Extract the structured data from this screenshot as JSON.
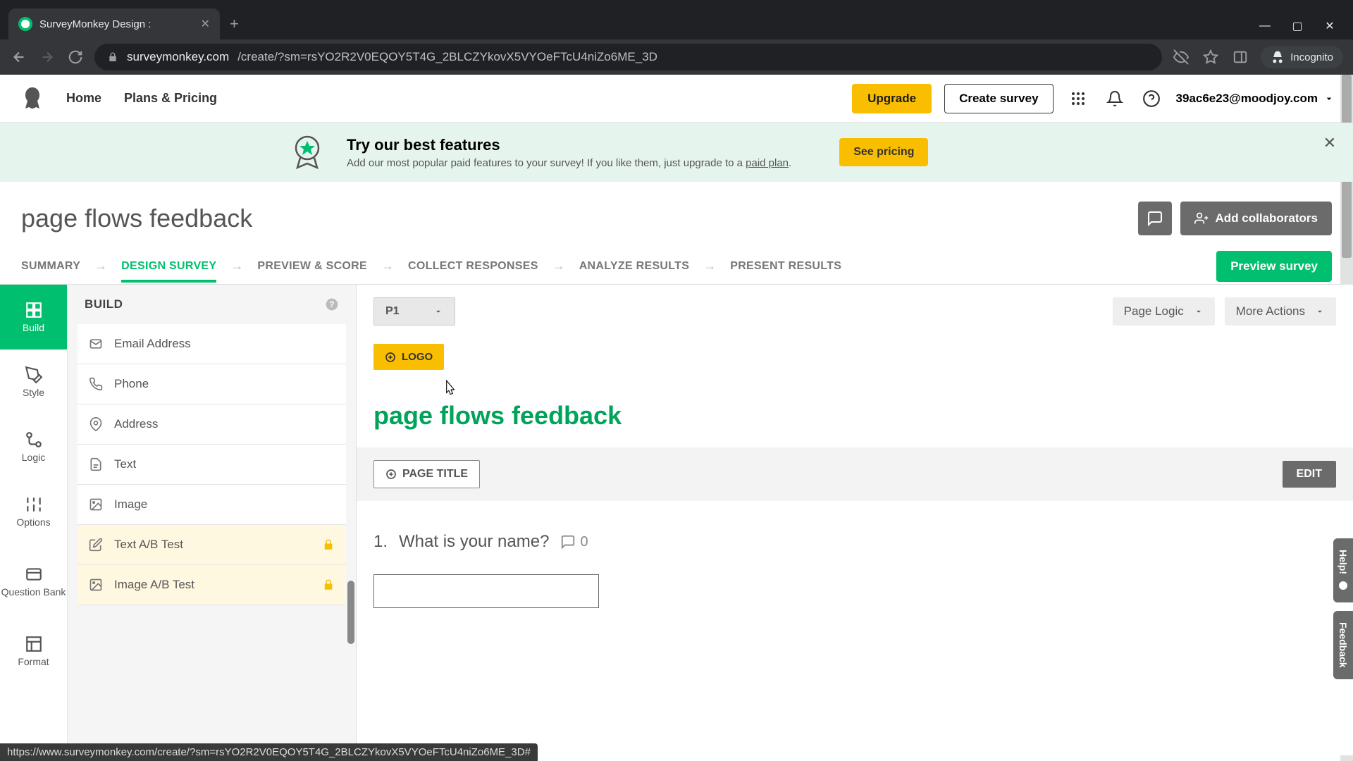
{
  "browser": {
    "tab_title": "SurveyMonkey Design :",
    "url_domain": "surveymonkey.com",
    "url_path": "/create/?sm=rsYO2R2V0EQOY5T4G_2BLCZYkovX5VYOeFTcU4niZo6ME_3D",
    "incognito_label": "Incognito"
  },
  "topnav": {
    "home": "Home",
    "plans": "Plans & Pricing",
    "upgrade": "Upgrade",
    "create_survey": "Create survey",
    "account_email": "39ac6e23@moodjoy.com"
  },
  "banner": {
    "title": "Try our best features",
    "subtitle_prefix": "Add our most popular paid features to your survey! If you like them, just upgrade to a ",
    "subtitle_link": "paid plan",
    "cta": "See pricing"
  },
  "survey": {
    "title": "page flows feedback",
    "add_collaborators": "Add collaborators"
  },
  "steps": {
    "summary": "SUMMARY",
    "design": "DESIGN SURVEY",
    "preview": "PREVIEW & SCORE",
    "collect": "COLLECT RESPONSES",
    "analyze": "ANALYZE RESULTS",
    "present": "PRESENT RESULTS",
    "preview_btn": "Preview survey"
  },
  "rail": {
    "build": "Build",
    "style": "Style",
    "logic": "Logic",
    "options": "Options",
    "question_bank": "Question Bank",
    "format": "Format"
  },
  "build_panel": {
    "header": "BUILD",
    "items": [
      {
        "label": "Email Address",
        "icon": "mail",
        "locked": false
      },
      {
        "label": "Phone",
        "icon": "phone",
        "locked": false
      },
      {
        "label": "Address",
        "icon": "pin",
        "locked": false
      },
      {
        "label": "Text",
        "icon": "text",
        "locked": false
      },
      {
        "label": "Image",
        "icon": "image",
        "locked": false
      },
      {
        "label": "Text A/B Test",
        "icon": "ab",
        "locked": true
      },
      {
        "label": "Image A/B Test",
        "icon": "image",
        "locked": true
      }
    ]
  },
  "canvas": {
    "page_selector": "P1",
    "page_logic": "Page Logic",
    "more_actions": "More Actions",
    "logo_btn": "LOGO",
    "survey_heading": "page flows feedback",
    "page_title_btn": "PAGE TITLE",
    "edit_btn": "EDIT",
    "question_number": "1.",
    "question_text": "What is your name?",
    "comment_count": "0"
  },
  "side_tabs": {
    "help": "Help!",
    "feedback": "Feedback"
  },
  "status_link": "https://www.surveymonkey.com/create/?sm=rsYO2R2V0EQOY5T4G_2BLCZYkovX5VYOeFTcU4niZo6ME_3D#"
}
